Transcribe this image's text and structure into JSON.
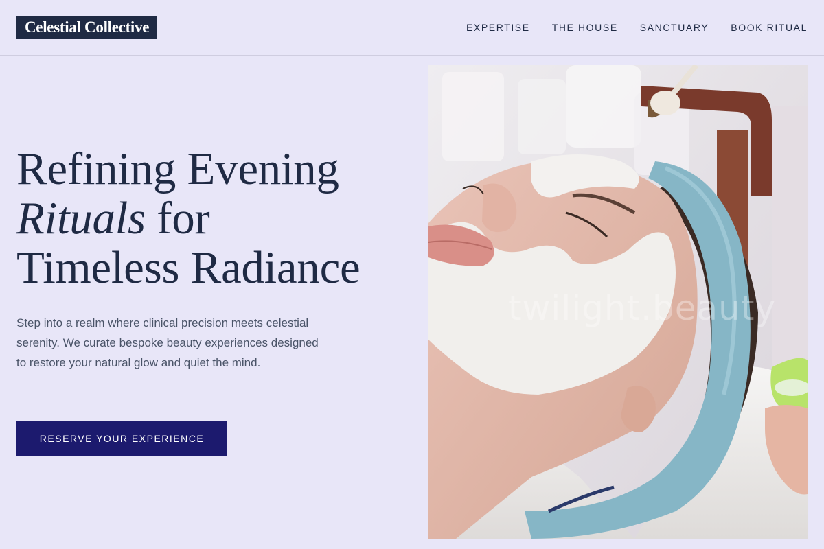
{
  "header": {
    "logo": "Celestial Collective",
    "nav": [
      {
        "label": "EXPERTISE"
      },
      {
        "label": "THE HOUSE"
      },
      {
        "label": "SANCTUARY"
      },
      {
        "label": "BOOK RITUAL"
      }
    ]
  },
  "hero": {
    "title_line1": "Refining Evening",
    "title_italic": "Rituals",
    "title_after_italic": " for",
    "title_line3": "Timeless Radiance",
    "lead": "Step into a realm where clinical precision meets celestial serenity. We curate bespoke beauty experiences designed to restore your natural glow and quiet the mind.",
    "cta": "RESERVE YOUR EXPERIENCE"
  },
  "image": {
    "subject": "facial-mask-treatment-photo",
    "watermark": "twilight.beauty"
  },
  "colors": {
    "background": "#e8e6f8",
    "ink": "#1f2a44",
    "cta": "#1c1a6e",
    "headband": "#86b6c6",
    "mask": "#f1efec"
  }
}
